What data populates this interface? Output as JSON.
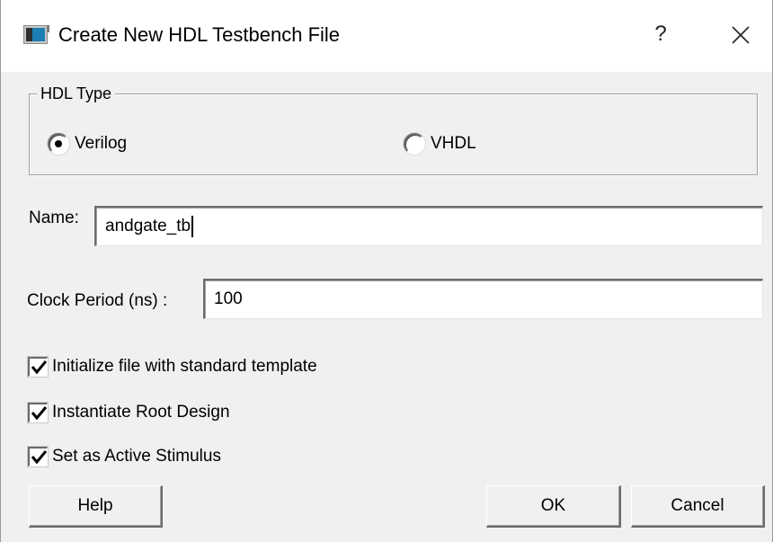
{
  "window": {
    "title": "Create New HDL Testbench File",
    "help_glyph": "?",
    "close_icon": "close-icon",
    "app_icon": "window-icon"
  },
  "hdl_type": {
    "legend": "HDL Type",
    "options": [
      {
        "label": "Verilog",
        "selected": true
      },
      {
        "label": "VHDL",
        "selected": false
      }
    ]
  },
  "name_field": {
    "label": "Name:",
    "value": "andgate_tb"
  },
  "clock_field": {
    "label": "Clock Period (ns) :",
    "value": "100"
  },
  "options": [
    {
      "label": "Initialize file with standard template",
      "checked": true
    },
    {
      "label": "Instantiate Root Design",
      "checked": true
    },
    {
      "label": "Set as Active Stimulus",
      "checked": true
    }
  ],
  "buttons": {
    "help": "Help",
    "ok": "OK",
    "cancel": "Cancel"
  }
}
